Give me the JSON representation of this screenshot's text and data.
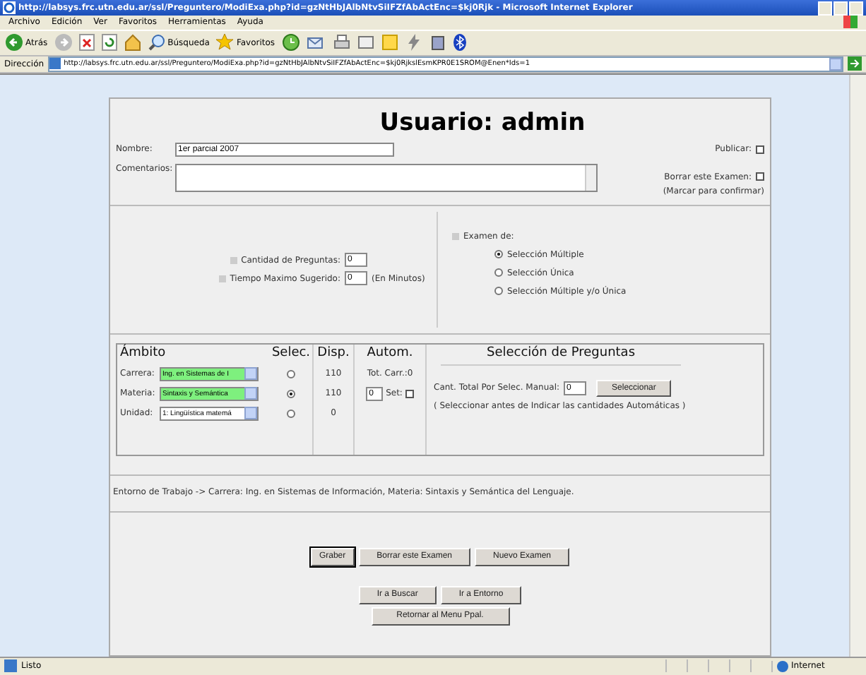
{
  "window": {
    "title": "http://labsys.frc.utn.edu.ar/ssl/Preguntero/ModiExa.php?id=gzNtHbJAlbNtvSiIFZfAbActEnc=$kj0Rjk - Microsoft Internet Explorer"
  },
  "menu": [
    "Archivo",
    "Edición",
    "Ver",
    "Favoritos",
    "Herramientas",
    "Ayuda"
  ],
  "toolbar": {
    "back": "Atrás",
    "search": "Búsqueda",
    "favorites": "Favoritos"
  },
  "address": {
    "label": "Dirección",
    "url": "http://labsys.frc.utn.edu.ar/ssl/Preguntero/ModiExa.php?id=gzNtHbJAlbNtvSiIFZfAbActEnc=$kj0RjkslEsmKPR0E1SROM@Enen*Ids=1"
  },
  "page": {
    "heading": "Usuario: admin",
    "name": {
      "label": "Nombre:",
      "value": "1er parcial 2007"
    },
    "publish": {
      "label": "Publicar:",
      "checked": false
    },
    "comments": {
      "label": "Comentarios:"
    },
    "delete": {
      "label": "Borrar este Examen:",
      "checked": false,
      "note": "(Marcar para confirmar)"
    },
    "count": {
      "label": "Cantidad de Preguntas:",
      "value": "0"
    },
    "time": {
      "label": "Tiempo Maximo Sugerido:",
      "value": "0",
      "unit": "(En Minutos)"
    },
    "exam_type": {
      "label": "Examen de:",
      "options": [
        {
          "label": "Selección Múltiple",
          "selected": true
        },
        {
          "label": "Selección Única",
          "selected": false
        },
        {
          "label": "Selección Múltiple y/o Única",
          "selected": false
        }
      ]
    },
    "scope": {
      "headers": [
        "Ámbito",
        "Selec.",
        "Disp.",
        "Autom.",
        "Selección de Preguntas"
      ],
      "rows": [
        {
          "label": "Carrera:",
          "value": "Ing. en Sistemas de I",
          "highlighted": true,
          "selected": false,
          "available": "110"
        },
        {
          "label": "Materia:",
          "value": "Sintaxis y Semántica",
          "highlighted": true,
          "selected": true,
          "available": "110"
        },
        {
          "label": "Unidad:",
          "value": "1: Lingüística matemá",
          "highlighted": false,
          "selected": false,
          "available": "0"
        }
      ],
      "total": "Tot. Carr.:0",
      "auto_value": "0",
      "set": {
        "label": "Set:",
        "checked": false
      },
      "manual": {
        "label": "Cant. Total Por Selec. Manual:",
        "value": "0",
        "button": "Seleccionar",
        "note": "( Seleccionar antes de Indicar las cantidades Automáticas )"
      }
    },
    "context": "Entorno de Trabajo -> Carrera: Ing. en Sistemas de Información, Materia: Sintaxis y Semántica del Lenguaje.",
    "buttons": [
      {
        "label": "Graber",
        "focused": true
      },
      {
        "label": "Borrar este Examen",
        "focused": false
      },
      {
        "label": "Nuevo Examen",
        "focused": false
      }
    ],
    "nav_buttons": [
      "Ir a Buscar",
      "Ir a Entorno"
    ],
    "menu_button": "Retornar al Menu Ppal."
  },
  "status_bar": {
    "text": "Listo",
    "zone": "Internet"
  }
}
